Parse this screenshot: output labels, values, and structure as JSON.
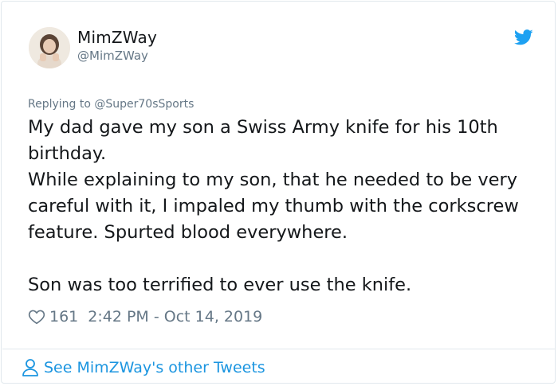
{
  "tweet": {
    "author": {
      "display_name": "MimZWay",
      "handle": "@MimZWay",
      "avatar_icon": "profile-photo"
    },
    "brand_icon": "twitter-bird-icon",
    "brand_color": "#1da1f2",
    "replying_to": "Replying to @Super70sSports",
    "text": {
      "line1": "My dad gave my son a Swiss Army knife for his 10th birthday.",
      "line2": "While explaining to my son, that he needed to be very careful with it, I impaled my thumb with the corkscrew feature. Spurted blood everywhere.",
      "line3": "Son was too terrified to ever use the knife."
    },
    "likes": "161",
    "timestamp": "2:42 PM - Oct 14, 2019"
  },
  "footer": {
    "link_label": "See MimZWay's other Tweets",
    "link_color": "#1b95e0"
  }
}
